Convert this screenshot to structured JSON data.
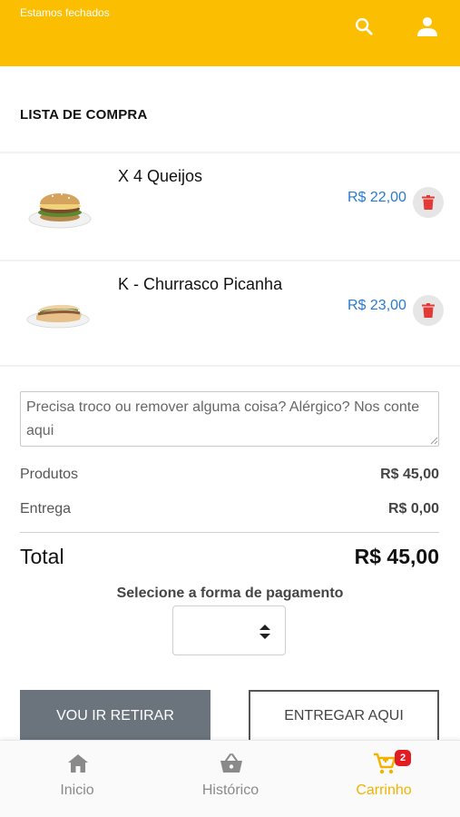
{
  "header": {
    "status": "Estamos fechados",
    "search_icon": "search-icon",
    "user_icon": "user-icon",
    "color": "#fbbe00"
  },
  "cart": {
    "title": "LISTA DE COMPRA",
    "items": [
      {
        "name": "X 4 Queijos",
        "price": "R$ 22,00",
        "image": "burger",
        "delete_icon": "trash-icon"
      },
      {
        "name": "K - Churrasco Picanha",
        "price": "R$ 23,00",
        "image": "sandwich",
        "delete_icon": "trash-icon"
      }
    ]
  },
  "notes": {
    "placeholder": "Precisa troco ou remover alguma coisa? Alérgico? Nos conte aqui",
    "value": ""
  },
  "summary": {
    "products_label": "Produtos",
    "products_value": "R$ 45,00",
    "delivery_label": "Entrega",
    "delivery_value": "R$ 0,00",
    "total_label": "Total",
    "total_value": "R$ 45,00"
  },
  "payment": {
    "label": "Selecione a forma de pagamento",
    "selected": ""
  },
  "actions": {
    "pickup": "VOU IR RETIRAR",
    "deliver": "ENTREGAR AQUI"
  },
  "bottom_nav": {
    "items": [
      {
        "label": "Inicio",
        "icon": "home-icon",
        "active": false
      },
      {
        "label": "Histórico",
        "icon": "basket-icon",
        "active": false
      },
      {
        "label": "Carrinho",
        "icon": "cart-icon",
        "active": true,
        "badge": "2"
      }
    ],
    "active_color": "#f0b400",
    "badge_color": "#e31b23"
  },
  "colors": {
    "price": "#2a7ad0",
    "delete": "#e53935",
    "primary_button": "#6b747d"
  }
}
